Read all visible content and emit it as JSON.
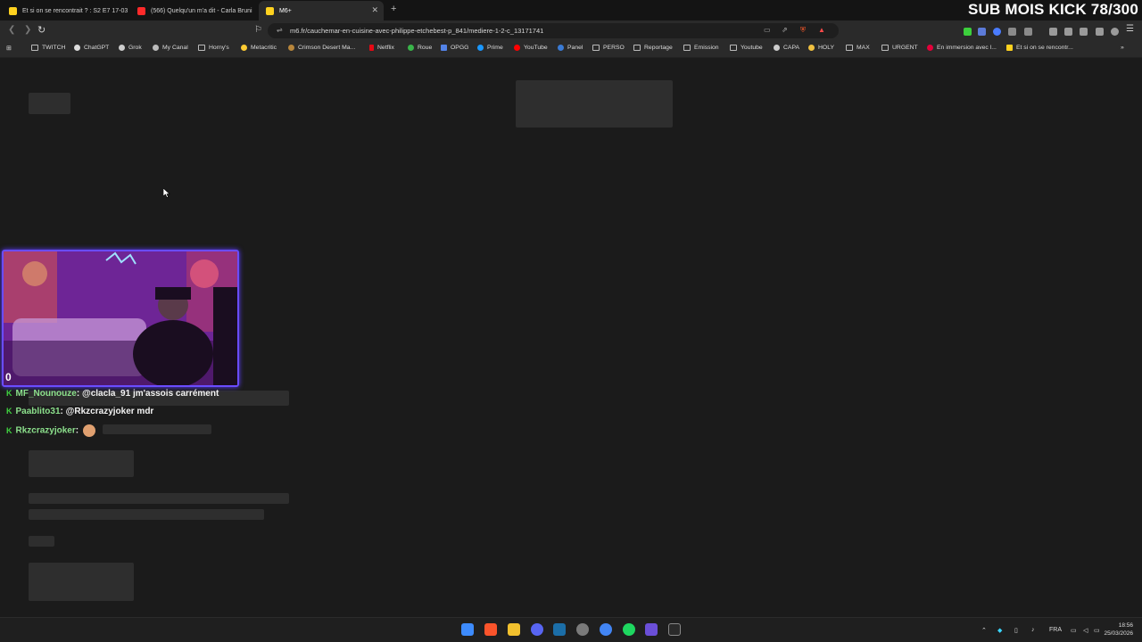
{
  "overlay": {
    "title": "SUB MOIS KICK 78/300"
  },
  "tabs": [
    {
      "label": "Et si on se rencontrait ? : S2 E7 17-03",
      "favicon_color": "#ffd21f"
    },
    {
      "label": "(566) Quelqu'un m'a dit - Carla Bruni",
      "favicon_color": "#ff2a2a"
    },
    {
      "label": "M6+",
      "favicon_color": "#ffd21f"
    }
  ],
  "navbar": {
    "url": "m6.fr/cauchemar-en-cuisine-avec-philippe-etchebest-p_841/mediere-1-2-c_13171741"
  },
  "bookmarks": [
    {
      "label": "TWITCH",
      "icon": "folder-icon"
    },
    {
      "label": "ChatGPT",
      "icon": "chatgpt-icon"
    },
    {
      "label": "Grok",
      "icon": "grok-icon"
    },
    {
      "label": "My Canal",
      "icon": "canal-icon"
    },
    {
      "label": "Horny's",
      "icon": "folder-icon"
    },
    {
      "label": "Metacritic",
      "icon": "metacritic-icon"
    },
    {
      "label": "Crimson Desert Ma...",
      "icon": "crimson-icon"
    },
    {
      "label": "Netflix",
      "icon": "netflix-icon"
    },
    {
      "label": "Roue",
      "icon": "roue-icon"
    },
    {
      "label": "OPGG",
      "icon": "opgg-icon"
    },
    {
      "label": "Prime",
      "icon": "prime-icon"
    },
    {
      "label": "YouTube",
      "icon": "youtube-icon"
    },
    {
      "label": "Panel",
      "icon": "panel-icon"
    },
    {
      "label": "PERSO",
      "icon": "folder-icon"
    },
    {
      "label": "Reportage",
      "icon": "folder-icon"
    },
    {
      "label": "Emission",
      "icon": "folder-icon"
    },
    {
      "label": "Youtube",
      "icon": "folder-icon"
    },
    {
      "label": "CAPA",
      "icon": "capa-icon"
    },
    {
      "label": "HOLY",
      "icon": "holy-icon"
    },
    {
      "label": "MAX",
      "icon": "folder-icon"
    },
    {
      "label": "URGENT",
      "icon": "folder-icon"
    },
    {
      "label": "En immersion avec l...",
      "icon": "red-dot-icon"
    },
    {
      "label": "Et si on se rencontr...",
      "icon": "m6-icon"
    }
  ],
  "webcam": {
    "viewer_count": "0"
  },
  "chat": [
    {
      "user": "MF_Nounouze",
      "message": "@clacla_91 jm'assois carrément"
    },
    {
      "user": "Paablito31",
      "message": "@Rkzcrazyjoker mdr"
    },
    {
      "user": "Rkzcrazyjoker",
      "message": ""
    }
  ],
  "taskbar": {
    "language": "FRA",
    "time": "18:56",
    "date": "25/03/2026"
  }
}
